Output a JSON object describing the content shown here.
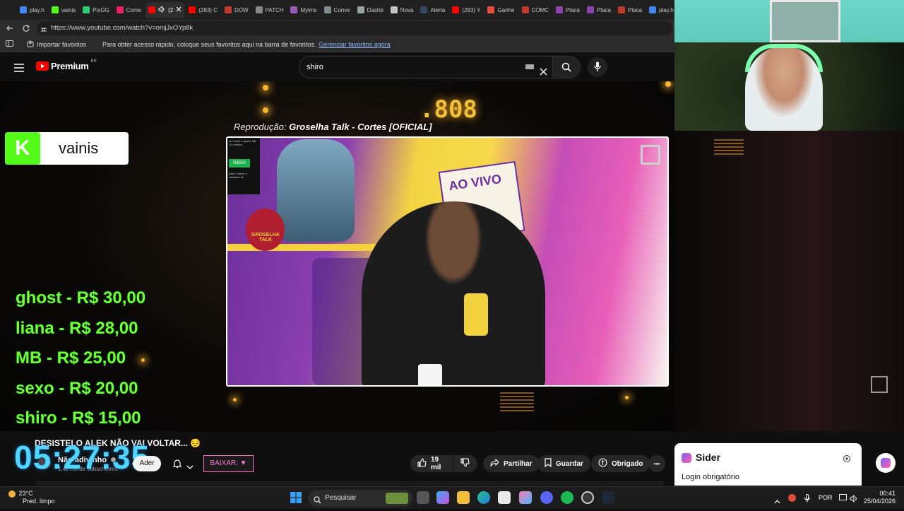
{
  "browser": {
    "tabs": [
      {
        "label": "play.h",
        "color": "#4285f4"
      },
      {
        "label": "vainis",
        "color": "#53fc18"
      },
      {
        "label": "PixGG",
        "color": "#2ecc71"
      },
      {
        "label": "Come",
        "color": "#e91e63"
      },
      {
        "label": "(2",
        "color": "#ff0000",
        "active": true
      },
      {
        "label": "(283) C",
        "color": "#ff0000"
      },
      {
        "label": "DOW",
        "color": "#c0392b"
      },
      {
        "label": "PATCH",
        "color": "#888888"
      },
      {
        "label": "Myims",
        "color": "#9b59b6"
      },
      {
        "label": "Conve",
        "color": "#7f8c8d"
      },
      {
        "label": "Dashb",
        "color": "#95a5a6"
      },
      {
        "label": "Nova",
        "color": "#bdc3c7"
      },
      {
        "label": "Alerta",
        "color": "#34495e"
      },
      {
        "label": "(283) Y",
        "color": "#ff0000"
      },
      {
        "label": "Ganhe",
        "color": "#e74c3c"
      },
      {
        "label": "COMC",
        "color": "#c0392b"
      },
      {
        "label": "Placa",
        "color": "#8e44ad"
      },
      {
        "label": "Placa",
        "color": "#8e44ad"
      },
      {
        "label": "Placa",
        "color": "#c0392b"
      },
      {
        "label": "play.h",
        "color": "#4285f4"
      }
    ],
    "url": "https://www.youtube.com/watch?v=onijJxOYp8k",
    "url_host": "www.youtube.com",
    "favbar": {
      "import_label": "Importar favoritos",
      "hint": "Para obter acesso rápido, coloque seus favoritos aqui na barra de favoritos.",
      "manage_link": "Gerenciar favoritos agora"
    }
  },
  "youtube": {
    "logo_text": "Premium",
    "region": "BR",
    "search_value": "shiro",
    "now_playing_label": "Reprodução:",
    "now_playing_title": "Groselha Talk - Cortes [OFICIAL]",
    "video_title": "DESISTELO ALEK NÃO VAI VOLTAR... 😔",
    "channel_name": "Não adivinho",
    "subscribers": "1,42 mil de subscritores",
    "join_label": "Ader",
    "download_label": "BAIXAR: ▼",
    "likes": "19 mil",
    "share_label": "Partilhar",
    "save_label": "Guardar",
    "thanks_label": "Obrigado",
    "more_label": "•••"
  },
  "overlay": {
    "counter": ".808",
    "streamer_name": "vainis",
    "streamer_badge": "K",
    "donations": [
      {
        "text": "ghost - R$ 30,00"
      },
      {
        "text": "liana - R$ 28,00"
      },
      {
        "text": "MB - R$ 25,00"
      },
      {
        "text": "sexo - R$ 20,00"
      },
      {
        "text": "shiro - R$ 15,00"
      }
    ],
    "timer": "05:27:35"
  },
  "video": {
    "badge_text": "se Crash e ganhe R$ 10 milhões",
    "badge_button": "R$500",
    "badge_footer": "esse o bloze e cadastre-se",
    "sign_text_1": "AO VIVO",
    "figure_label": "GROSELHA TALK"
  },
  "sider": {
    "title": "Sider",
    "subtitle": "Login obrigatório"
  },
  "taskbar": {
    "temperature": "23°C",
    "weather_desc": "Pred. limpo",
    "search_placeholder": "Pesquisar",
    "language": "POR",
    "time": "00:41",
    "date": "25/04/2026"
  },
  "colors": {
    "donation_green": "#6cff3a",
    "timer_cyan": "#4fd6ff",
    "kick_green": "#53fc18",
    "counter_gold": "#f2c13c"
  }
}
